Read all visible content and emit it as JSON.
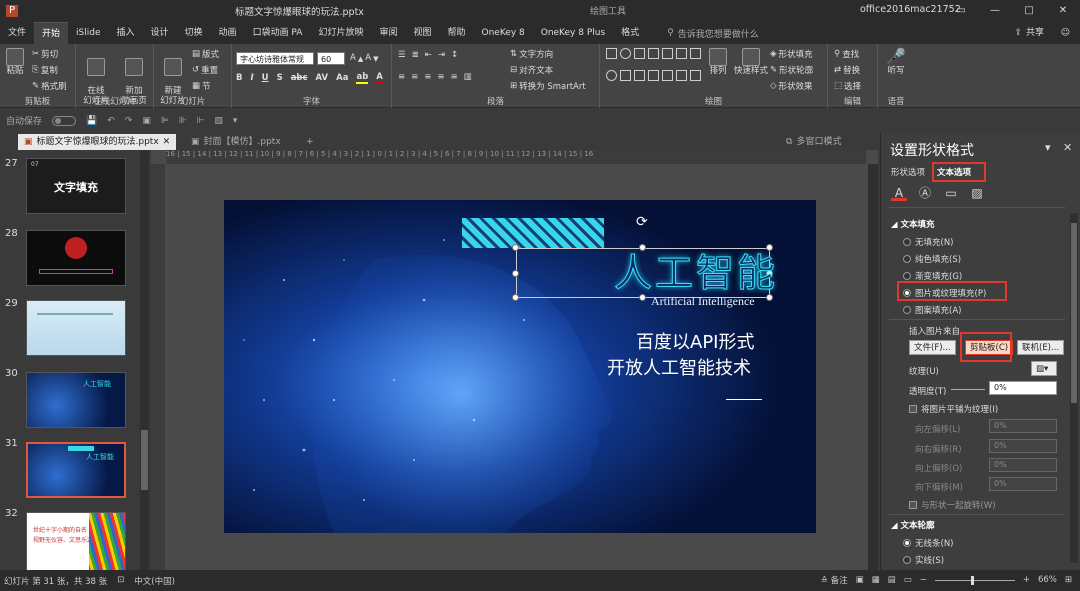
{
  "window": {
    "doc_title": "标题文字惊爆眼球的玩法.pptx",
    "context_tab_label": "绘图工具",
    "user": "office2016mac21752",
    "controls": [
      "▭",
      "—",
      "□",
      "✕"
    ]
  },
  "tabs": [
    {
      "label": "文件"
    },
    {
      "label": "开始",
      "active": true
    },
    {
      "label": "iSlide"
    },
    {
      "label": "插入"
    },
    {
      "label": "设计"
    },
    {
      "label": "切换"
    },
    {
      "label": "动画"
    },
    {
      "label": "口袋动画 PA"
    },
    {
      "label": "幻灯片放映"
    },
    {
      "label": "审阅"
    },
    {
      "label": "视图"
    },
    {
      "label": "帮助"
    },
    {
      "label": "OneKey 8"
    },
    {
      "label": "OneKey 8 Plus"
    },
    {
      "label": "格式"
    }
  ],
  "tell_me": "告诉我您想要做什么",
  "share": "共享",
  "ribbon": {
    "clipboard": {
      "paste": "粘贴",
      "cut": "剪切",
      "copy": "复制",
      "format_painter": "格式刷",
      "label": "剪贴板"
    },
    "online_slides": {
      "online": "在线\n幻灯片",
      "new": "新加\n动画页",
      "label": "在线幻灯片"
    },
    "slides": {
      "new_slide": "新建\n幻灯片",
      "layout": "版式",
      "reset": "重置",
      "section": "节",
      "label": "幻灯片"
    },
    "font": {
      "font_name": "字心坊诗雅体常规",
      "font_size": "60",
      "label": "字体"
    },
    "paragraph": {
      "text_direction": "文字方向",
      "align_text": "对齐文本",
      "smartart": "转换为 SmartArt",
      "label": "段落"
    },
    "drawing": {
      "arrange": "排列",
      "quick_styles": "快速样式",
      "fill": "形状填充",
      "outline": "形状轮廓",
      "effect": "形状效果",
      "label": "绘图"
    },
    "editing": {
      "find": "查找",
      "replace": "替换",
      "select": "选择",
      "label": "编辑"
    },
    "voice": {
      "dictate": "听写",
      "label": "语音"
    }
  },
  "qat": {
    "autosave": "自动保存"
  },
  "doc_tabs": [
    {
      "label": "标题文字惊爆眼球的玩法.pptx",
      "active": true
    },
    {
      "label": "封面【模仿】.pptx",
      "active": false
    }
  ],
  "multi_window": "多窗口模式",
  "thumbnails": [
    {
      "num": "27",
      "title": "文字填充",
      "small": "07"
    },
    {
      "num": "28"
    },
    {
      "num": "29"
    },
    {
      "num": "30",
      "title": "人工智能"
    },
    {
      "num": "31",
      "title": "人工智能",
      "selected": true
    },
    {
      "num": "32",
      "lines": [
        "世纪十字小期的自名",
        "视野无仪容、文思乐源"
      ]
    }
  ],
  "ruler_text": "16 | 15 | 14 | 13 | 12 | 11 | 10 | 9 | 8 | 7 | 6 | 5 | 4 | 3 | 2 | 1 | 0 | 1 | 2 | 3 | 4 | 5 | 6 | 7 | 8 | 9 | 10 | 11 | 12 | 13 | 14 | 15 | 16",
  "slide": {
    "title": "人工智能",
    "subtitle": "Artificial Intelligence",
    "line1": "百度以API形式",
    "line2": "开放人工智能技术"
  },
  "pane": {
    "title": "设置形状格式",
    "tab_shape": "形状选项",
    "tab_text": "文本选项",
    "text_fill_head": "文本填充",
    "fill_options": [
      "无填充(N)",
      "纯色填充(S)",
      "渐变填充(G)",
      "图片或纹理填充(P)",
      "图案填充(A)"
    ],
    "insert_from": "插入图片来自",
    "btn_file": "文件(F)...",
    "btn_clipboard": "剪贴板(C)",
    "btn_online": "联机(E)...",
    "texture": "纹理(U)",
    "transparency": "透明度(T)",
    "transparency_value": "0%",
    "tile_label": "将图片平铺为纹理(I)",
    "offset_left": "向左偏移(L)",
    "offset_right": "向右偏移(R)",
    "offset_top": "向上偏移(O)",
    "offset_bottom": "向下偏移(M)",
    "offset_values": [
      "0%",
      "0%",
      "0%",
      "0%"
    ],
    "rotate_with": "与形状一起旋转(W)",
    "outline_head": "文本轮廓",
    "outline_options": [
      "无线条(N)",
      "实线(S)"
    ]
  },
  "status": {
    "slide_info": "幻灯片 第 31 张，共 38 张",
    "language": "中文(中国)",
    "notes": "备注",
    "zoom": "66%"
  },
  "colors": {
    "accent": "#b7472a",
    "highlight": "#e0392b",
    "slide_cyan": "#38e2f4"
  }
}
